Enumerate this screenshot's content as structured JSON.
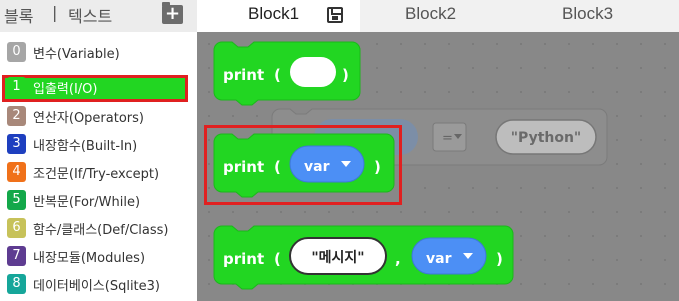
{
  "mode_tabs": {
    "blocks": "블록",
    "separator": "|",
    "text": "텍스트",
    "add_icon": "add-folder-icon"
  },
  "file_tabs": [
    {
      "label": "Block1",
      "icon": "save-icon"
    },
    {
      "label": "Block2"
    },
    {
      "label": "Block3"
    }
  ],
  "categories": [
    {
      "num": "0",
      "label": "변수(Variable)",
      "color": "#a6a6a6"
    },
    {
      "num": "1",
      "label": "입출력(I/O)",
      "color": "#22d622",
      "selected": true
    },
    {
      "num": "2",
      "label": "연산자(Operators)",
      "color": "#a8887a"
    },
    {
      "num": "3",
      "label": "내장함수(Built-In)",
      "color": "#1e3fbf"
    },
    {
      "num": "4",
      "label": "조건문(If/Try-except)",
      "color": "#f0711a"
    },
    {
      "num": "5",
      "label": "반복문(For/While)",
      "color": "#13a84a"
    },
    {
      "num": "6",
      "label": "함수/클래스(Def/Class)",
      "color": "#c7c25a"
    },
    {
      "num": "7",
      "label": "내장모듈(Modules)",
      "color": "#5e3c91"
    },
    {
      "num": "8",
      "label": "데이터베이스(Sqlite3)",
      "color": "#16a69a"
    }
  ],
  "workspace": {
    "keyword_print": "print",
    "open_paren": "(",
    "close_paren": ")",
    "comma": ",",
    "var_label": "var",
    "message_label": "\"메시지\"",
    "python_label": "\"Python\"",
    "equals_label": "=",
    "colors": {
      "print_block": "#22d622",
      "var_pill": "#4c8ff5",
      "ghost": "#8d8d8d"
    }
  }
}
